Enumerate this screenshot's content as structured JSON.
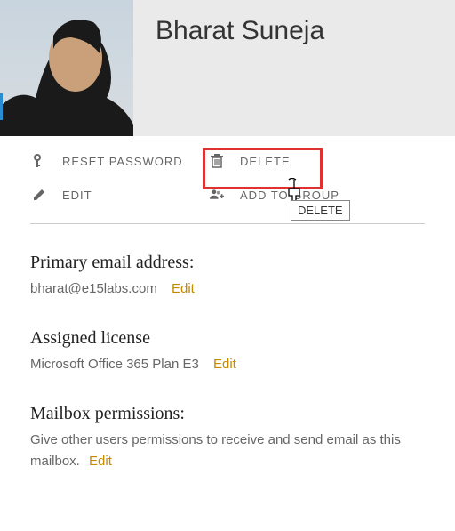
{
  "user_name": "Bharat Suneja",
  "actions": {
    "reset_password": "RESET PASSWORD",
    "delete": "DELETE",
    "edit": "EDIT",
    "add_to_group": "ADD TO GROUP"
  },
  "tooltip": "DELETE",
  "sections": {
    "email": {
      "title": "Primary email address:",
      "value": "bharat@e15labs.com",
      "edit": "Edit"
    },
    "license": {
      "title": "Assigned license",
      "value": "Microsoft Office 365 Plan E3",
      "edit": "Edit"
    },
    "mailbox": {
      "title": "Mailbox permissions:",
      "value": "Give other users permissions to receive and send email as this mailbox.",
      "edit": "Edit"
    }
  }
}
